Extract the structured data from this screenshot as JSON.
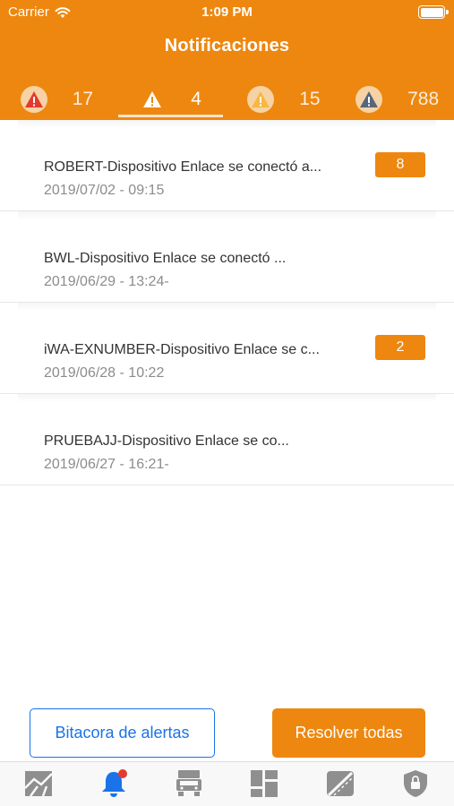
{
  "status_bar": {
    "carrier": "Carrier",
    "time": "1:09 PM"
  },
  "header": {
    "title": "Notificaciones"
  },
  "colors": {
    "accent": "#ee870f",
    "link_blue": "#1a73e8",
    "alert_red": "#e23b2e",
    "alert_yellow": "#f6b93f",
    "alert_gray": "#56677a",
    "icon_gray": "#8f8f8f"
  },
  "tabs": [
    {
      "icon": "warning-red-icon",
      "count": "17",
      "active": false
    },
    {
      "icon": "warning-white-icon",
      "count": "4",
      "active": true
    },
    {
      "icon": "warning-yellow-icon",
      "count": "15",
      "active": false
    },
    {
      "icon": "warning-gray-icon",
      "count": "788",
      "active": false
    }
  ],
  "notifications": [
    {
      "title": "ROBERT-Dispositivo Enlace se conectó a...",
      "date": "2019/07/02 - 09:15",
      "badge": "8"
    },
    {
      "title": "BWL-Dispositivo Enlace se conectó ...",
      "date": "2019/06/29 - 13:24-",
      "badge": ""
    },
    {
      "title": "iWA-EXNUMBER-Dispositivo Enlace se c...",
      "date": "2019/06/28 - 10:22",
      "badge": "2"
    },
    {
      "title": "PRUEBAJJ-Dispositivo Enlace se co...",
      "date": "2019/06/27 - 16:21-",
      "badge": ""
    }
  ],
  "buttons": {
    "log": "Bitacora de alertas",
    "resolve_all": "Resolver todas"
  },
  "tabbar": [
    {
      "icon": "map-icon",
      "active": false
    },
    {
      "icon": "bell-icon",
      "active": true,
      "has_dot": true
    },
    {
      "icon": "truck-icon",
      "active": false
    },
    {
      "icon": "dashboard-icon",
      "active": false
    },
    {
      "icon": "route-icon",
      "active": false
    },
    {
      "icon": "shield-lock-icon",
      "active": false
    }
  ]
}
